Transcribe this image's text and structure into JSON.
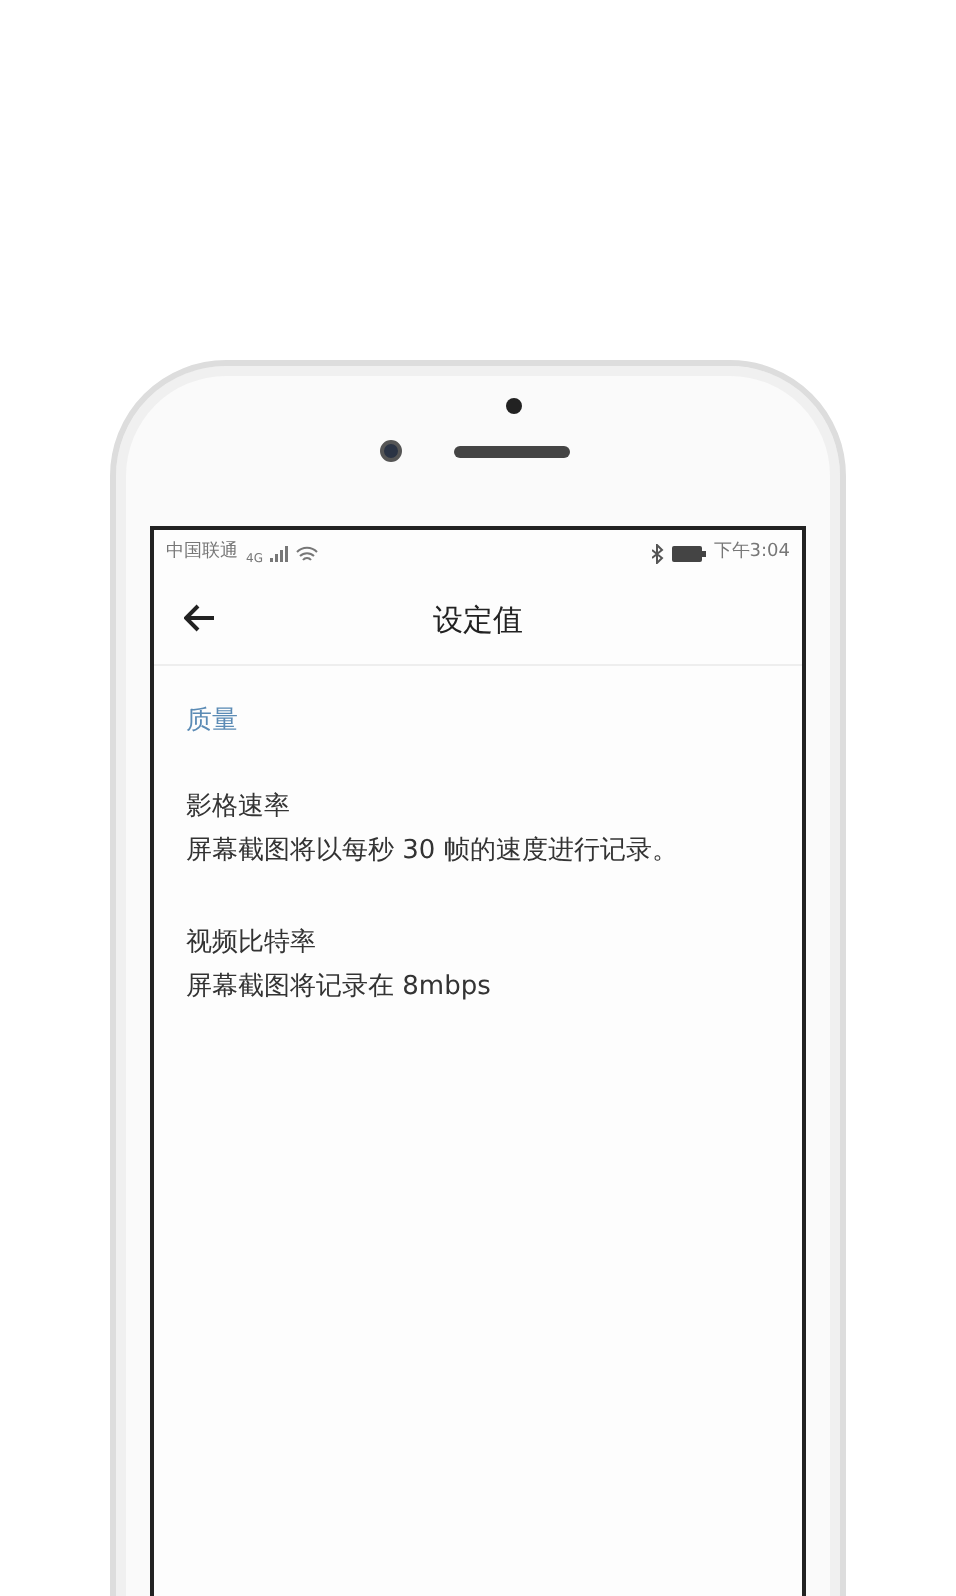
{
  "status_bar": {
    "carrier": "中国联通",
    "network": "4G",
    "time": "下午3:04"
  },
  "header": {
    "title": "设定值"
  },
  "section": {
    "title": "质量"
  },
  "settings": [
    {
      "title": "影格速率",
      "summary": "屏幕截图将以每秒 30 帧的速度进行记录。"
    },
    {
      "title": "视频比特率",
      "summary": "屏幕截图将记录在 8mbps"
    }
  ]
}
